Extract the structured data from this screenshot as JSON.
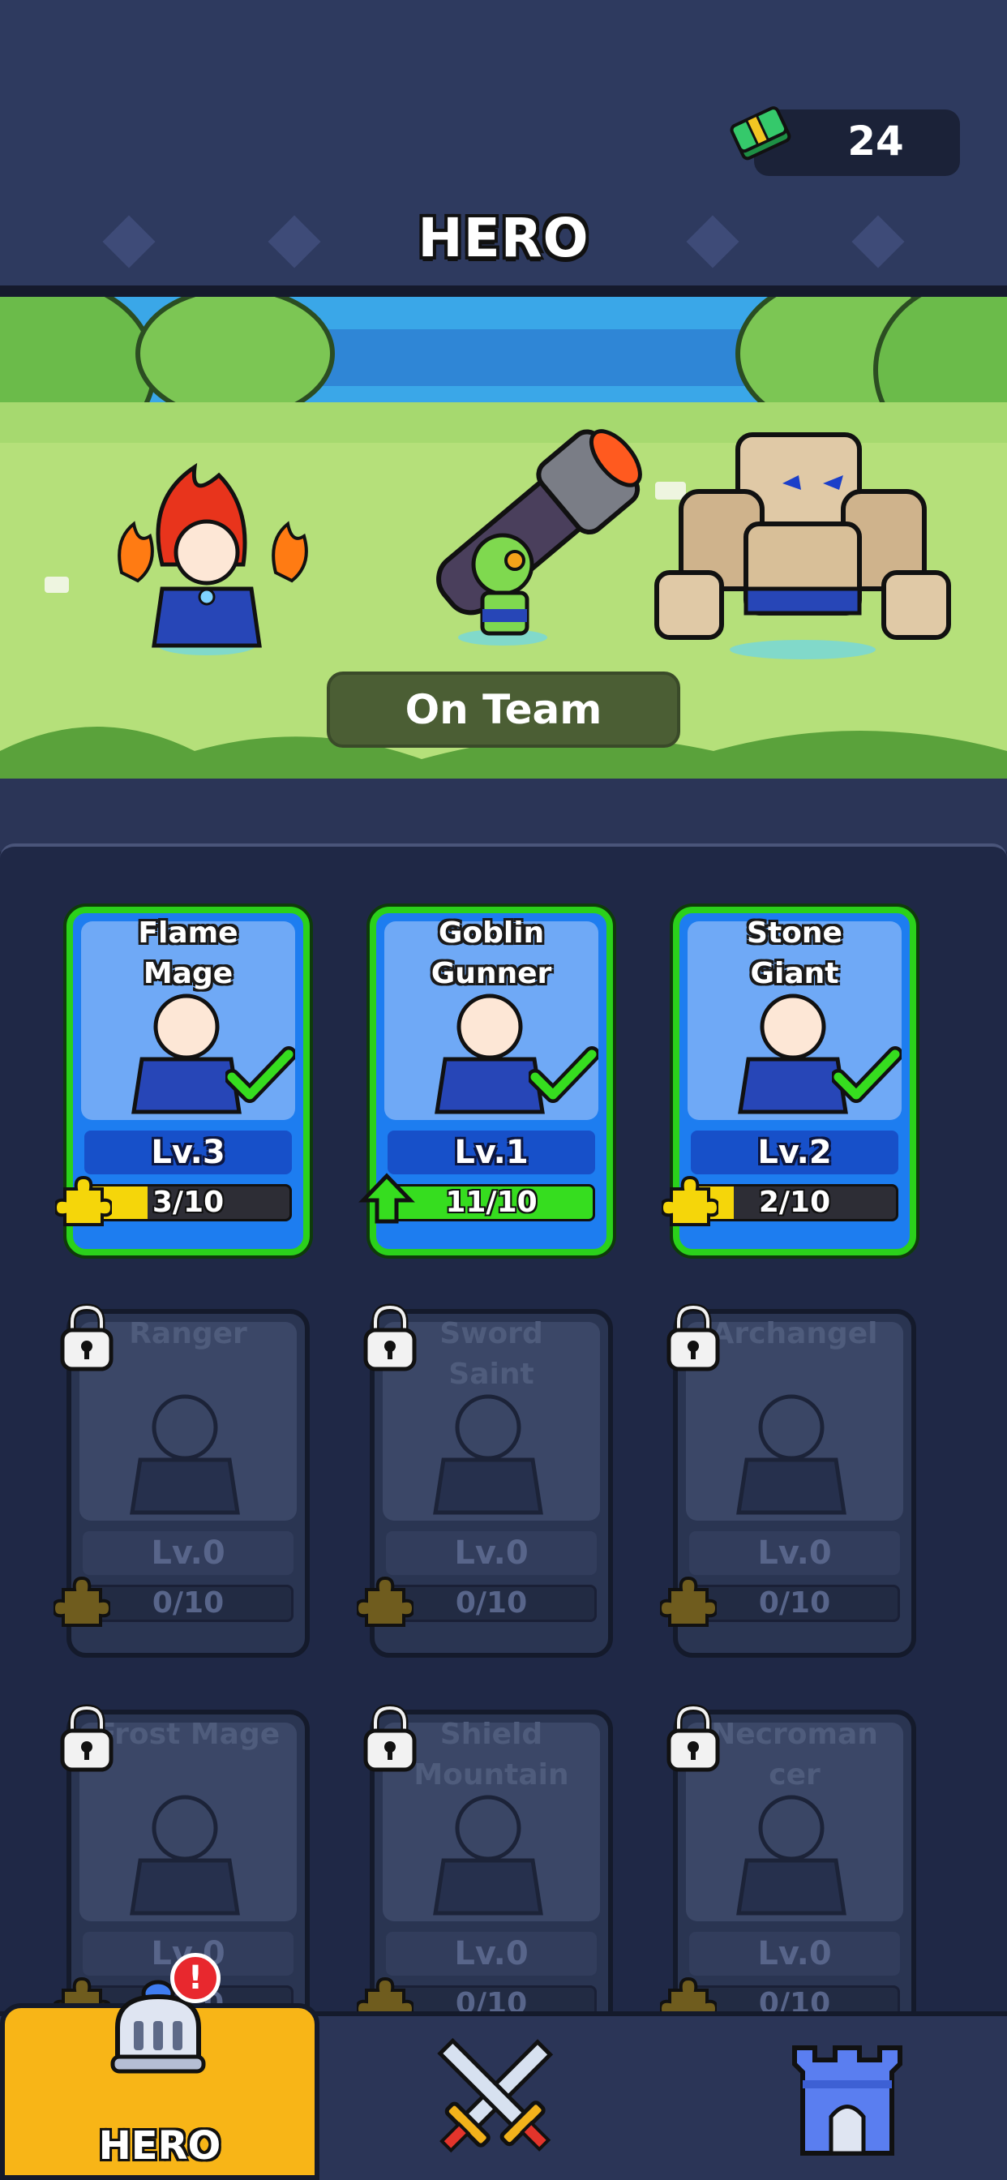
{
  "header": {
    "title": "HERO",
    "cash_value": "24",
    "cash_icon": "cash-stack-icon"
  },
  "scene": {
    "status_label": "On Team",
    "team": [
      "Flame Mage",
      "Goblin Gunner",
      "Stone Giant"
    ]
  },
  "roster": [
    {
      "name": "Flame\nMage",
      "level": "Lv.3",
      "progress": "3/10",
      "fraction": 0.3,
      "state": "on-team"
    },
    {
      "name": "Goblin\nGunner",
      "level": "Lv.1",
      "progress": "11/10",
      "fraction": 1.0,
      "state": "on-team"
    },
    {
      "name": "Stone\nGiant",
      "level": "Lv.2",
      "progress": "2/10",
      "fraction": 0.2,
      "state": "on-team"
    },
    {
      "name": "Ranger",
      "level": "Lv.0",
      "progress": "0/10",
      "fraction": 0,
      "state": "locked"
    },
    {
      "name": "Sword\nSaint",
      "level": "Lv.0",
      "progress": "0/10",
      "fraction": 0,
      "state": "locked"
    },
    {
      "name": "Archangel",
      "level": "Lv.0",
      "progress": "0/10",
      "fraction": 0,
      "state": "locked"
    },
    {
      "name": "Frost Mage",
      "level": "Lv.0",
      "progress": "0/10",
      "fraction": 0,
      "state": "locked"
    },
    {
      "name": "Shield\nMountain",
      "level": "Lv.0",
      "progress": "0/10",
      "fraction": 0,
      "state": "locked"
    },
    {
      "name": "Necroman\ncer",
      "level": "Lv.0",
      "progress": "0/10",
      "fraction": 0,
      "state": "locked"
    }
  ],
  "nav": {
    "tabs": [
      {
        "label": "HERO",
        "icon": "knight-helmet-icon",
        "active": true,
        "alert": "!"
      },
      {
        "label": "",
        "icon": "crossed-swords-icon",
        "active": false
      },
      {
        "label": "",
        "icon": "castle-icon",
        "active": false
      }
    ]
  },
  "colors": {
    "header_bg": "#2e3a5f",
    "panel_bg": "#1f2846",
    "owned_border": "#2bd11b",
    "card_blue": "#1d7df0",
    "active_tab": "#f8b517",
    "progress_yellow": "#f5d60a",
    "progress_green": "#36dd1f"
  }
}
